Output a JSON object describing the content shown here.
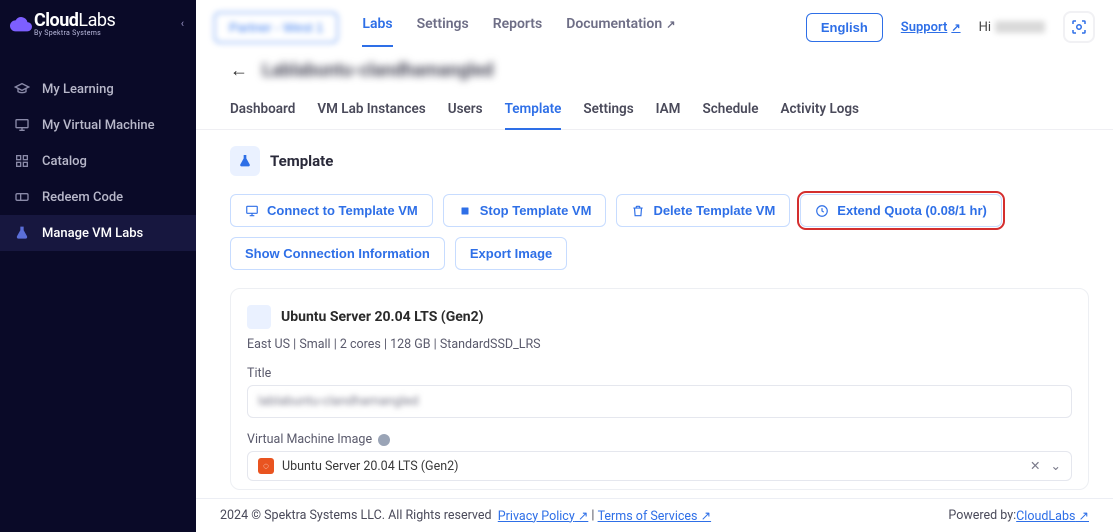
{
  "brand": {
    "name1": "Cloud",
    "name2": "Labs",
    "sub": "By Spektra Systems"
  },
  "sidebar": {
    "items": [
      {
        "label": "My Learning"
      },
      {
        "label": "My Virtual Machine"
      },
      {
        "label": "Catalog"
      },
      {
        "label": "Redeem Code"
      },
      {
        "label": "Manage VM Labs"
      }
    ]
  },
  "topnav": {
    "partner": "Partner - West 1",
    "items": [
      {
        "label": "Labs"
      },
      {
        "label": "Settings"
      },
      {
        "label": "Reports"
      },
      {
        "label": "Documentation"
      }
    ],
    "lang": "English",
    "support": "Support",
    "hi": "Hi"
  },
  "breadcrumb": {
    "title": "Lablabuntu-clandhamangled"
  },
  "subtabs": [
    {
      "label": "Dashboard"
    },
    {
      "label": "VM Lab Instances"
    },
    {
      "label": "Users"
    },
    {
      "label": "Template"
    },
    {
      "label": "Settings"
    },
    {
      "label": "IAM"
    },
    {
      "label": "Schedule"
    },
    {
      "label": "Activity Logs"
    }
  ],
  "section": {
    "title": "Template"
  },
  "buttons": {
    "connect": "Connect to Template VM",
    "stop": "Stop Template VM",
    "delete": "Delete Template VM",
    "extend": "Extend Quota (0.08/1 hr)",
    "showconn": "Show Connection Information",
    "export": "Export Image"
  },
  "template": {
    "os_title": "Ubuntu Server 20.04 LTS (Gen2)",
    "meta": "East US | Small | 2 cores | 128 GB | StandardSSD_LRS",
    "title_label": "Title",
    "title_value": "lablabuntu-clandhamangled",
    "vmi_label": "Virtual Machine Image",
    "vmi_value": "Ubuntu Server 20.04 LTS (Gen2)"
  },
  "footer": {
    "copyright": "2024 © Spektra Systems LLC. All Rights reserved",
    "privacy": "Privacy Policy",
    "terms": "Terms of Services",
    "powered_pre": "Powered by: ",
    "powered": "CloudLabs"
  }
}
